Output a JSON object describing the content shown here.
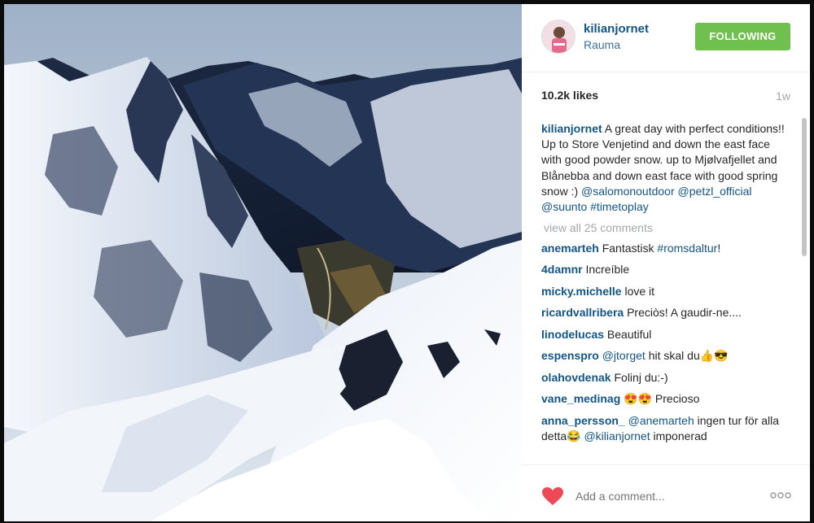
{
  "post": {
    "username": "kilianjornet",
    "location": "Rauma",
    "follow_label": "FOLLOWING",
    "likes": "10.2k likes",
    "time": "1w"
  },
  "caption": {
    "username": "kilianjornet",
    "text": " A great day with perfect conditions!! Up to Store Venjetind and down the east face with good powder snow. up to Mjølvafjellet and Blånebba and down east face with good spring snow :) ",
    "tags": [
      "@salomonoutdoor",
      "@petzl_official",
      "@suunto",
      "#timetoplay"
    ]
  },
  "view_all": "view all 25 comments",
  "comments": [
    {
      "user": "anemarteh",
      "text": "Fantastisk ",
      "tag": "#romsdaltur",
      "after": "!"
    },
    {
      "user": "4damnr",
      "text": "Increíble",
      "tag": "",
      "after": ""
    },
    {
      "user": "micky.michelle",
      "text": "love it",
      "tag": "",
      "after": ""
    },
    {
      "user": "ricardvallribera",
      "text": "Preciòs! A gaudir-ne....",
      "tag": "",
      "after": ""
    },
    {
      "user": "linodelucas",
      "text": "Beautiful",
      "tag": "",
      "after": ""
    },
    {
      "user": "espenspro",
      "text": "",
      "tag": "@jtorget",
      "after": " hit skal du👍😎"
    },
    {
      "user": "olahovdenak",
      "text": "Folinj du:-)",
      "tag": "",
      "after": ""
    },
    {
      "user": "vane_medinag",
      "text": "😍😍 Precioso",
      "tag": "",
      "after": ""
    },
    {
      "user": "anna_persson_",
      "text": "",
      "tag": "@anemarteh",
      "after": " ingen tur för alla detta😂 ",
      "tag2": "@kilianjornet",
      "after2": " imponerad"
    }
  ],
  "footer": {
    "placeholder": "Add a comment...",
    "heart_icon": "heart-icon",
    "more_icon": "more-options-icon",
    "heart_color": "#ed4956"
  },
  "colors": {
    "follow_bg": "#70c050",
    "link": "#125688",
    "location": "#3f729b"
  }
}
